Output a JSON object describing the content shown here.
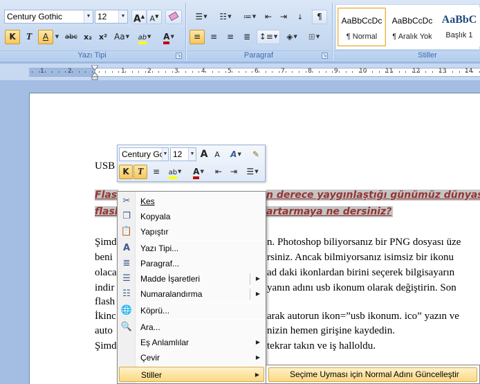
{
  "ribbon": {
    "font_name": "Century Gothic",
    "font_size": "12",
    "group_font_label": "Yazı Tipi",
    "group_paragraph_label": "Paragraf",
    "group_styles_label": "Stiller",
    "btn_grow": "A",
    "btn_shrink": "A",
    "btn_bold": "K",
    "btn_italic": "T",
    "btn_underline": "A",
    "btn_strike": "abc",
    "btn_subscript": "x₂",
    "btn_superscript": "x²",
    "btn_case": "Aa",
    "btn_highlight": "ab",
    "btn_fontcolor": "A",
    "styles": [
      {
        "sample": "AaBbCcDc",
        "name": "¶ Normal"
      },
      {
        "sample": "AaBbCcDc",
        "name": "¶ Aralık Yok"
      },
      {
        "sample": "AaBbC",
        "name": "Başlık 1"
      }
    ],
    "colors": {
      "highlight": "#ffff00",
      "font": "#c00000",
      "accent": "#f8c65c"
    }
  },
  "ruler": {
    "numbers": [
      "1",
      "2",
      "1",
      "2",
      "3",
      "4",
      "5",
      "6",
      "7",
      "8",
      "9",
      "10",
      "11",
      "12",
      "13",
      "14"
    ]
  },
  "document": {
    "line_usb": "USB",
    "heading_1_left": "Flas",
    "heading_1_right": "n derece yaygınlaştığı günümüz dünyası",
    "heading_2_left": "flash",
    "heading_2_right": "artarmaya ne dersiniz?",
    "lines_left": [
      "Şimd",
      "beni",
      "olaca",
      "indir",
      "flash",
      "İkinc",
      "auto",
      "Şimd"
    ],
    "lines_right": [
      "n. Photoshop biliyorsanız bir PNG dosyası üze",
      "rsiniz.  Ancak bilmiyorsanız isimsiz bir ikonu",
      "ad daki ikonlardan birini seçerek bilgisayarın",
      "yanın adını usb ikonum olarak değiştirin. Son",
      "",
      "arak autorun ikon=”usb ikonum. ico” yazın ve",
      "nizin hemen girişine kaydedin.",
      "tekrar takın ve iş halloldu."
    ]
  },
  "mini_toolbar": {
    "font_name": "Century Gc",
    "font_size": "12",
    "btn_grow": "A",
    "btn_shrink": "A",
    "btn_styles": "A",
    "btn_bold": "K",
    "btn_italic": "T",
    "btn_fontcolor": "A"
  },
  "context_menu": {
    "items": [
      {
        "label": "Kes",
        "icon": "scissors-icon"
      },
      {
        "label": "Kopyala",
        "icon": "copy-icon"
      },
      {
        "label": "Yapıştır",
        "icon": "paste-icon"
      },
      {
        "label": "Yazı Tipi...",
        "icon": "font-icon"
      },
      {
        "label": "Paragraf...",
        "icon": "paragraph-icon"
      },
      {
        "label": "Madde İşaretleri",
        "icon": "bullets-icon",
        "submenu": true
      },
      {
        "label": "Numaralandırma",
        "icon": "numbering-icon",
        "submenu": true
      },
      {
        "label": "Köprü...",
        "icon": "hyperlink-icon"
      },
      {
        "label": "Ara...",
        "icon": "lookup-icon"
      },
      {
        "label": "Eş Anlamlılar",
        "submenu": true
      },
      {
        "label": "Çevir",
        "submenu": true
      },
      {
        "label": "Stiller",
        "submenu": true
      }
    ],
    "submenu_item": "Seçime Uyması için Normal Adını Güncelleştir"
  }
}
